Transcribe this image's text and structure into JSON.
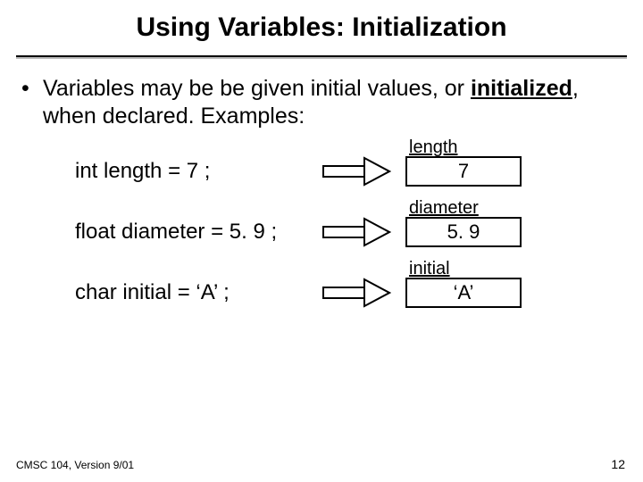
{
  "title": "Using Variables: Initialization",
  "bullet": {
    "dot": "•",
    "text_pre": "Variables may be be given initial values, or ",
    "text_bold": "initialized",
    "text_post": ", when declared.  Examples:"
  },
  "rows": [
    {
      "decl": "int length = 7 ;",
      "label": "length",
      "value": "7"
    },
    {
      "decl": "float diameter = 5. 9 ;",
      "label": "diameter",
      "value": "5. 9"
    },
    {
      "decl": "char initial = ‘A’ ;",
      "label": "initial",
      "value": "‘A’"
    }
  ],
  "footer": {
    "course": "CMSC 104, Version 9/01",
    "page": "12"
  }
}
